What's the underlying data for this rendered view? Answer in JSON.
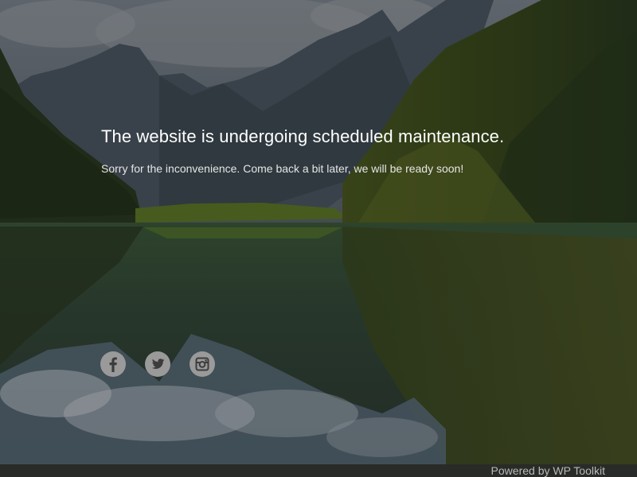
{
  "maintenance": {
    "headline": "The website is undergoing scheduled maintenance.",
    "subline": "Sorry for the inconvenience. Come back a bit later, we will be ready soon!"
  },
  "social": {
    "icons": [
      "facebook-icon",
      "twitter-icon",
      "instagram-icon"
    ],
    "icon_color": "#9a9a9a"
  },
  "footer": {
    "text": "Powered by WP Toolkit"
  }
}
